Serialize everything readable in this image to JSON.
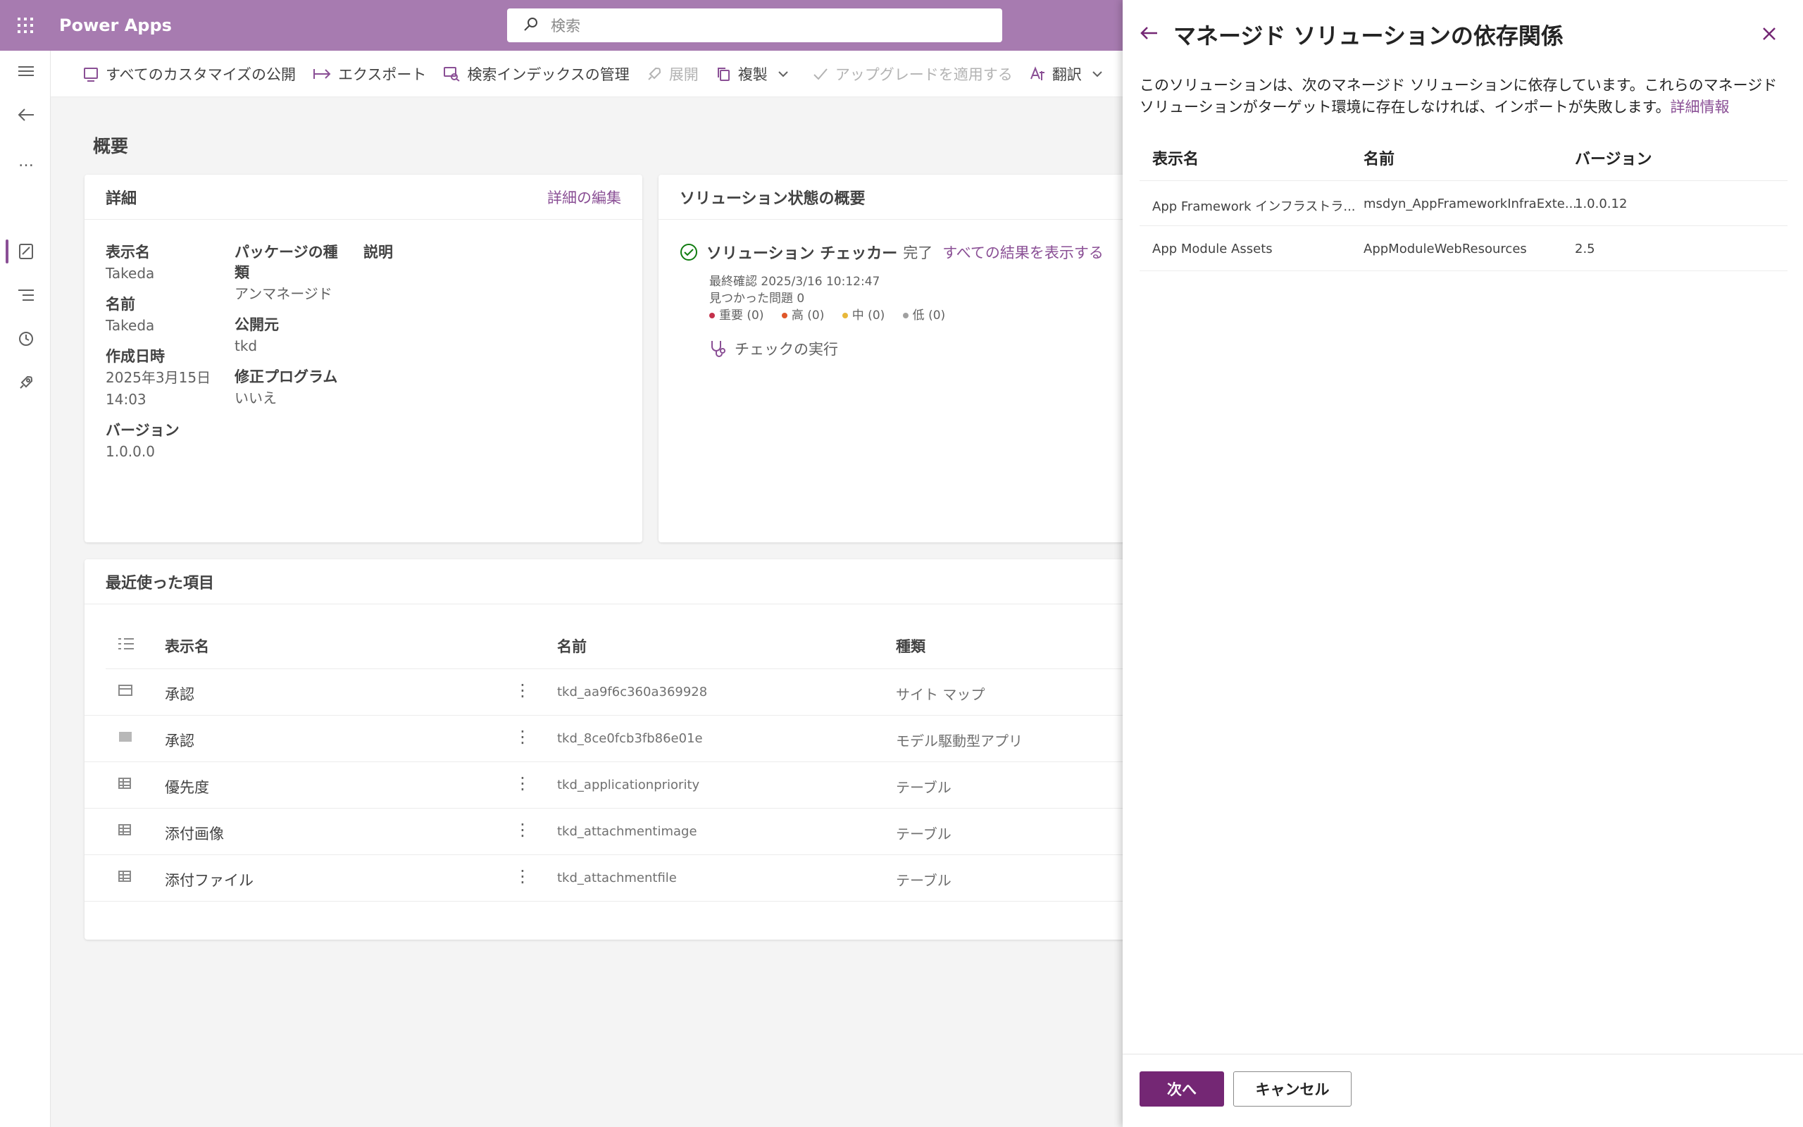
{
  "header": {
    "app_name": "Power Apps",
    "search_placeholder": "検索"
  },
  "commandbar": {
    "publish_all": "すべてのカスタマイズの公開",
    "export": "エクスポート",
    "manage_search_index": "検索インデックスの管理",
    "deploy": "展開",
    "clone": "複製",
    "apply_upgrade": "アップグレードを適用する",
    "translate": "翻訳"
  },
  "page": {
    "title": "概要"
  },
  "details_card": {
    "title": "詳細",
    "edit_link": "詳細の編集",
    "display_name_label": "表示名",
    "display_name_value": "Takeda",
    "name_label": "名前",
    "name_value": "Takeda",
    "created_label": "作成日時",
    "created_value_1": "2025年3月15日",
    "created_value_2": "14:03",
    "version_label": "バージョン",
    "version_value": "1.0.0.0",
    "package_type_label_1": "パッケージの種",
    "package_type_label_2": "類",
    "package_type_value": "アンマネージド",
    "publisher_label": "公開元",
    "publisher_value": "tkd",
    "patch_label": "修正プログラム",
    "patch_value": "いいえ",
    "description_label": "説明"
  },
  "status_card": {
    "title": "ソリューション状態の概要",
    "checker_label": "ソリューション チェッカー",
    "checker_status": "完了",
    "view_all_link": "すべての結果を表示する",
    "last_checked": "最終確認 2025/3/16 10:12:47",
    "issues_found": "見つかった問題 0",
    "critical": "重要 (0)",
    "high": "高 (0)",
    "medium": "中 (0)",
    "low": "低 (0)",
    "run_check": "チェックの実行",
    "colors": {
      "critical": "#c4314b",
      "high": "#e0572a",
      "medium": "#e8b83a",
      "low": "#a0a0a0"
    }
  },
  "recent": {
    "title": "最近使った項目",
    "columns": {
      "display_name": "表示名",
      "name": "名前",
      "type": "種類"
    },
    "rows": [
      {
        "display_name": "承認",
        "name": "tkd_aa9f6c360a369928",
        "type": "サイト マップ",
        "icon": "sitemap-icon"
      },
      {
        "display_name": "承認",
        "name": "tkd_8ce0fcb3fb86e01e",
        "type": "モデル駆動型アプリ",
        "icon": "app-icon"
      },
      {
        "display_name": "優先度",
        "name": "tkd_applicationpriority",
        "type": "テーブル",
        "icon": "table-icon"
      },
      {
        "display_name": "添付画像",
        "name": "tkd_attachmentimage",
        "type": "テーブル",
        "icon": "table-icon"
      },
      {
        "display_name": "添付ファイル",
        "name": "tkd_attachmentfile",
        "type": "テーブル",
        "icon": "table-icon"
      }
    ]
  },
  "panel": {
    "title": "マネージド ソリューションの依存関係",
    "description": "このソリューションは、次のマネージド ソリューションに依存しています。これらのマネージド ソリューションがターゲット環境に存在しなければ、インポートが失敗します。",
    "more_info_link": "詳細情報",
    "columns": {
      "display_name": "表示名",
      "name": "名前",
      "version": "バージョン"
    },
    "rows": [
      {
        "display_name": "App Framework インフラストラ...",
        "name": "msdyn_AppFrameworkInfraExte...",
        "version": "1.0.0.12"
      },
      {
        "display_name": "App Module Assets",
        "name": "AppModuleWebResources",
        "version": "2.5"
      }
    ],
    "next_button": "次へ",
    "cancel_button": "キャンセル"
  },
  "colors": {
    "brand_header": "#a77bb0",
    "accent": "#742774",
    "link": "#8a4f95"
  }
}
